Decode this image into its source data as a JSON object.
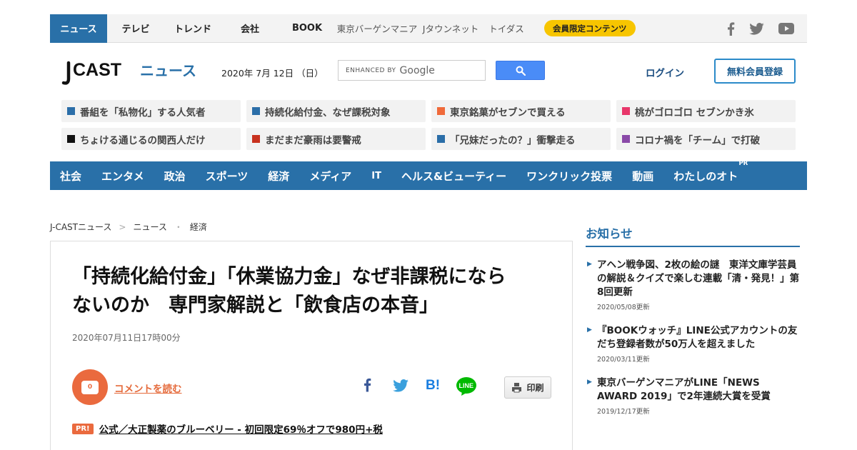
{
  "topnav": {
    "items": [
      {
        "label": "ニュース",
        "active": true
      },
      {
        "label": "テレビ"
      },
      {
        "label": "トレンド"
      },
      {
        "label": "会社"
      },
      {
        "label": "BOOK"
      }
    ],
    "sub_items": [
      "東京バーゲンマニア",
      "Jタウンネット",
      "トイダス"
    ],
    "member_label": "会員限定コンテンツ",
    "social_icons": [
      "facebook-icon",
      "twitter-icon",
      "youtube-icon"
    ]
  },
  "header": {
    "logo_j": "J",
    "logo_cast": "CAST",
    "logo_news": "ニュース",
    "date": "2020年 7月 12日 （日）",
    "search_prefix": "ENHANCED BY",
    "search_brand": "Google",
    "login": "ログイン",
    "register": "無料会員登録"
  },
  "pickup": [
    {
      "text": "番組を「私物化」する人気者",
      "color": "#2b6ea8"
    },
    {
      "text": "持続化給付金、なぜ課税対象",
      "color": "#2b6ea8"
    },
    {
      "text": "東京銘菓がセブンで買える",
      "color": "#f06a3a"
    },
    {
      "text": "桃がゴロゴロ セブンかき氷",
      "color": "#e8366a"
    },
    {
      "text": "ちょける通じるの関西人だけ",
      "color": "#111111"
    },
    {
      "text": "まだまだ豪雨は要警戒",
      "color": "#c8321f"
    },
    {
      "text": "「兄妹だったの？」衝撃走る",
      "color": "#2b6ea8"
    },
    {
      "text": "コロナ禍を「チーム」で打破",
      "color": "#8a4aa8"
    }
  ],
  "catnav": [
    "社会",
    "エンタメ",
    "政治",
    "スポーツ",
    "経済",
    "メディア",
    "IT",
    "ヘルス&ビューティー",
    "ワンクリック投票",
    "動画",
    "わたしのオト"
  ],
  "catnav_pr": "PR",
  "breadcrumb": [
    "J-CASTニュース",
    "ニュース",
    "経済"
  ],
  "article": {
    "title_line1": "「持続化給付金」「休業協力金」なぜ非課税になら",
    "title_line2": "ないのか　専門家解説と「飲食店の本音」",
    "date": "2020年07月11日17時00分",
    "comment_count": "0",
    "comment_label": "コメントを読む",
    "print_label": "印刷",
    "share_icons": [
      "facebook-share-icon",
      "twitter-share-icon",
      "hatena-bookmark-icon",
      "line-icon"
    ],
    "pr_badge": "PR!",
    "pr_text": "公式／大正製薬のブルーベリー - 初回限定69％オフで980円+税"
  },
  "sidebar": {
    "title": "お知らせ",
    "items": [
      {
        "text": "アヘン戦争図、2枚の絵の謎　東洋文庫学芸員の解説＆クイズで楽しむ連載「清・発見！」第8回更新",
        "date": "2020/05/08更新"
      },
      {
        "text": "『BOOKウォッチ』LINE公式アカウントの友だち登録者数が50万人を超えました",
        "date": "2020/03/11更新"
      },
      {
        "text": "東京バーゲンマニアがLINE「NEWS AWARD 2019」で2年連続大賞を受賞",
        "date": "2019/12/17更新"
      }
    ]
  }
}
